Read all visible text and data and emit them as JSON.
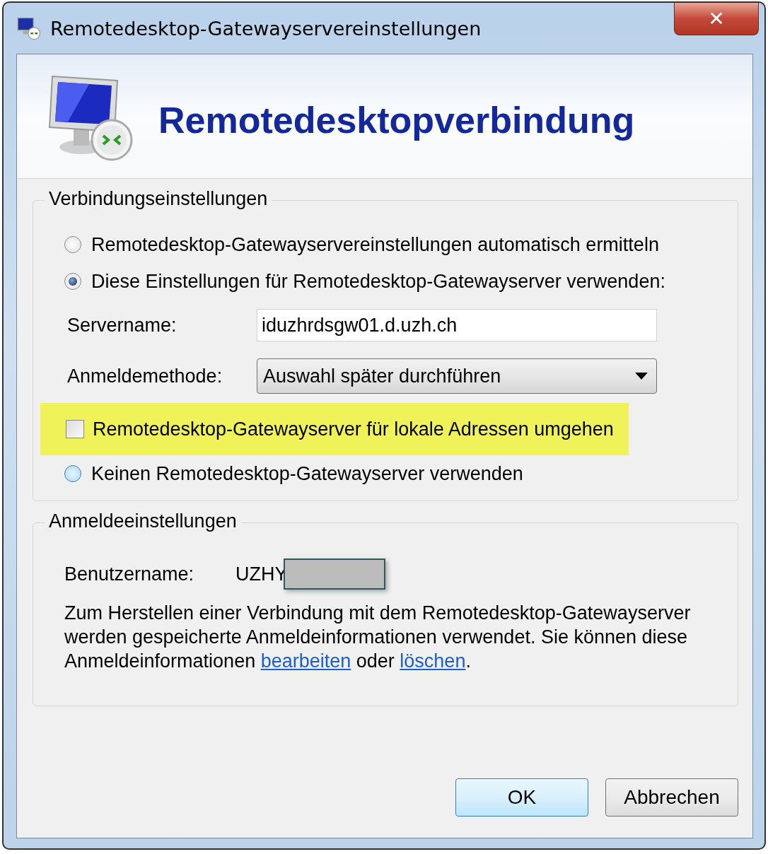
{
  "window": {
    "title": "Remotedesktop-Gatewayservereinstellungen",
    "close": "✕"
  },
  "header": {
    "title": "Remotedesktopverbindung"
  },
  "connection_settings": {
    "legend": "Verbindungseinstellungen",
    "options": [
      {
        "label": "Remotedesktop-Gatewayservereinstellungen automatisch ermitteln",
        "selected": false
      },
      {
        "label": "Diese Einstellungen für Remotedesktop-Gatewayserver verwenden:",
        "selected": true
      }
    ],
    "server_name": {
      "label": "Servername:",
      "value": "iduzhrdsgw01.d.uzh.ch"
    },
    "login_method": {
      "label": "Anmeldemethode:",
      "value": "Auswahl später durchführen"
    },
    "bypass": {
      "label": "Remotedesktop-Gatewayserver für lokale Adressen umgehen",
      "checked": false,
      "highlighted": true
    },
    "no_gateway": {
      "label": "Keinen Remotedesktop-Gatewayserver verwenden",
      "selected": false,
      "hovered": true
    }
  },
  "login_settings": {
    "legend": "Anmeldeeinstellungen",
    "username": {
      "label": "Benutzername:",
      "value": "UZHY",
      "redacted": true
    },
    "description": [
      {
        "kind": "text",
        "text": "Zum Herstellen einer Verbindung mit dem Remotedesktop-Gatewayserver werden gespeicherte Anmeldeinformationen verwendet. Sie können diese Anmeldeinformationen "
      },
      {
        "kind": "link",
        "text": "bearbeiten"
      },
      {
        "kind": "text",
        "text": " oder "
      },
      {
        "kind": "link",
        "text": "löschen"
      },
      {
        "kind": "text",
        "text": "."
      }
    ]
  },
  "buttons": [
    {
      "label": "OK",
      "default": true
    },
    {
      "label": "Abbrechen",
      "default": false
    }
  ]
}
